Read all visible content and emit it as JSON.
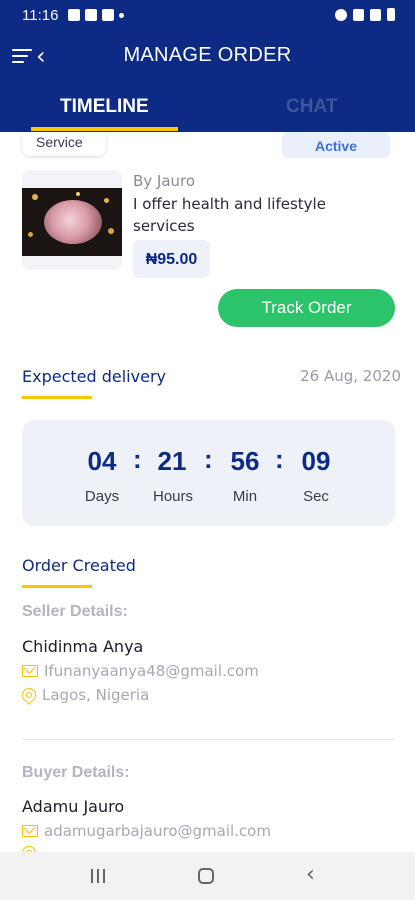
{
  "status_bar": {
    "time": "11:16"
  },
  "header": {
    "title": "MANAGE ORDER"
  },
  "tabs": [
    {
      "label": "TIMELINE",
      "active": true
    },
    {
      "label": "CHAT",
      "active": false
    }
  ],
  "order": {
    "category": "Service",
    "status": "Active",
    "seller_by": "By Jauro",
    "description": "I offer health and lifestyle services",
    "price": "₦95.00",
    "track_label": "Track Order"
  },
  "delivery": {
    "title": "Expected delivery",
    "date": "26 Aug, 2020",
    "countdown": [
      {
        "value": "04",
        "label": "Days"
      },
      {
        "value": "21",
        "label": "Hours"
      },
      {
        "value": "56",
        "label": "Min"
      },
      {
        "value": "09",
        "label": "Sec"
      }
    ],
    "separator": ":"
  },
  "order_created": {
    "title": "Order Created"
  },
  "seller": {
    "heading": "Seller Details:",
    "name": "Chidinma Anya",
    "email": "Ifunanyaanya48@gmail.com",
    "location": "Lagos, Nigeria"
  },
  "buyer": {
    "heading": "Buyer Details:",
    "name": "Adamu Jauro",
    "email": "adamugarbajauro@gmail.com"
  },
  "colors": {
    "primary": "#0d2b85",
    "accent": "#f7c600",
    "success": "#2bc46b",
    "active_chip": "#3d6fe0"
  }
}
